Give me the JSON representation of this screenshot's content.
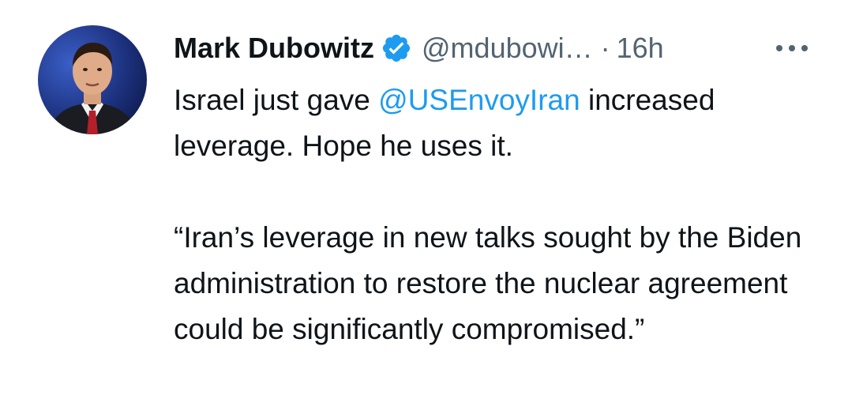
{
  "tweet": {
    "author": {
      "display_name": "Mark Dubowitz",
      "handle": "@mdubowi…",
      "verified_icon": "verified-badge-icon",
      "avatar_icon": "avatar-photo"
    },
    "separator": "·",
    "timestamp": "16h",
    "more_icon": "more-dots-icon",
    "text": {
      "line1_before": "Israel just gave ",
      "mention": "@USEnvoyIran",
      "line1_after": " increased leverage. Hope he uses it.",
      "quote": "“Iran’s leverage in new talks sought by the Biden administration to restore the nuclear agreement could be significantly compromised.”"
    }
  },
  "colors": {
    "text_primary": "#0f1419",
    "text_secondary": "#536471",
    "accent": "#1d9bf0"
  }
}
